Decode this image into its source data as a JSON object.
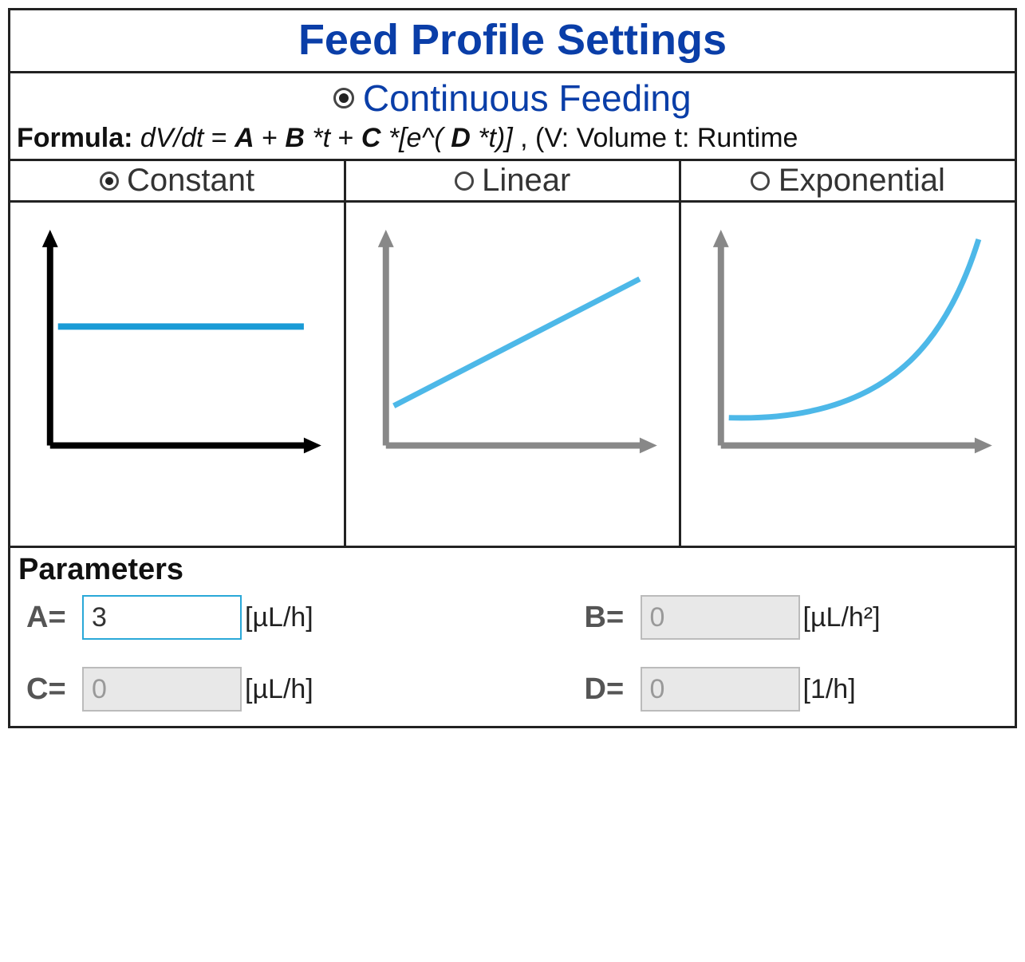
{
  "title": "Feed Profile Settings",
  "mode": {
    "label": "Continuous Feeding",
    "selected": true
  },
  "formula": {
    "prefix": "Formula:",
    "lhs": "dV/dt",
    "eq": "=",
    "A": "A",
    "plus1": "+",
    "B": "B",
    "t1": "*t",
    "plus2": "+",
    "C": "C",
    "exp_open": "*[e^(",
    "D": "D",
    "exp_close": "*t)]",
    "comma": ",",
    "tail": "(V: Volume t: Runtime"
  },
  "profiles": [
    {
      "name": "Constant",
      "selected": true
    },
    {
      "name": "Linear",
      "selected": false
    },
    {
      "name": "Exponential",
      "selected": false
    }
  ],
  "parameters_heading": "Parameters",
  "params": {
    "A": {
      "label": "A=",
      "value": "3",
      "unit": "[µL/h]",
      "enabled": true
    },
    "B": {
      "label": "B=",
      "value": "0",
      "unit": "[µL/h²]",
      "enabled": false
    },
    "C": {
      "label": "C=",
      "value": "0",
      "unit": "[µL/h]",
      "enabled": false
    },
    "D": {
      "label": "D=",
      "value": "0",
      "unit": "[1/h]",
      "enabled": false
    }
  },
  "chart_data": [
    {
      "type": "line",
      "title": "Constant",
      "xlabel": "",
      "ylabel": "",
      "x": [
        0,
        1,
        2,
        3,
        4,
        5,
        6,
        7,
        8,
        9,
        10
      ],
      "values": [
        5,
        5,
        5,
        5,
        5,
        5,
        5,
        5,
        5,
        5,
        5
      ],
      "xlim": [
        0,
        10
      ],
      "ylim": [
        0,
        10
      ]
    },
    {
      "type": "line",
      "title": "Linear",
      "xlabel": "",
      "ylabel": "",
      "x": [
        0,
        1,
        2,
        3,
        4,
        5,
        6,
        7,
        8,
        9,
        10
      ],
      "values": [
        2,
        2.6,
        3.2,
        3.8,
        4.4,
        5,
        5.6,
        6.2,
        6.8,
        7.4,
        8
      ],
      "xlim": [
        0,
        10
      ],
      "ylim": [
        0,
        10
      ]
    },
    {
      "type": "line",
      "title": "Exponential",
      "xlabel": "",
      "ylabel": "",
      "x": [
        0,
        1,
        2,
        3,
        4,
        5,
        6,
        7,
        8,
        9,
        10
      ],
      "values": [
        1.5,
        1.6,
        1.7,
        1.9,
        2.2,
        2.7,
        3.5,
        4.7,
        6.3,
        8.2,
        10
      ],
      "xlim": [
        0,
        10
      ],
      "ylim": [
        0,
        10
      ]
    }
  ]
}
